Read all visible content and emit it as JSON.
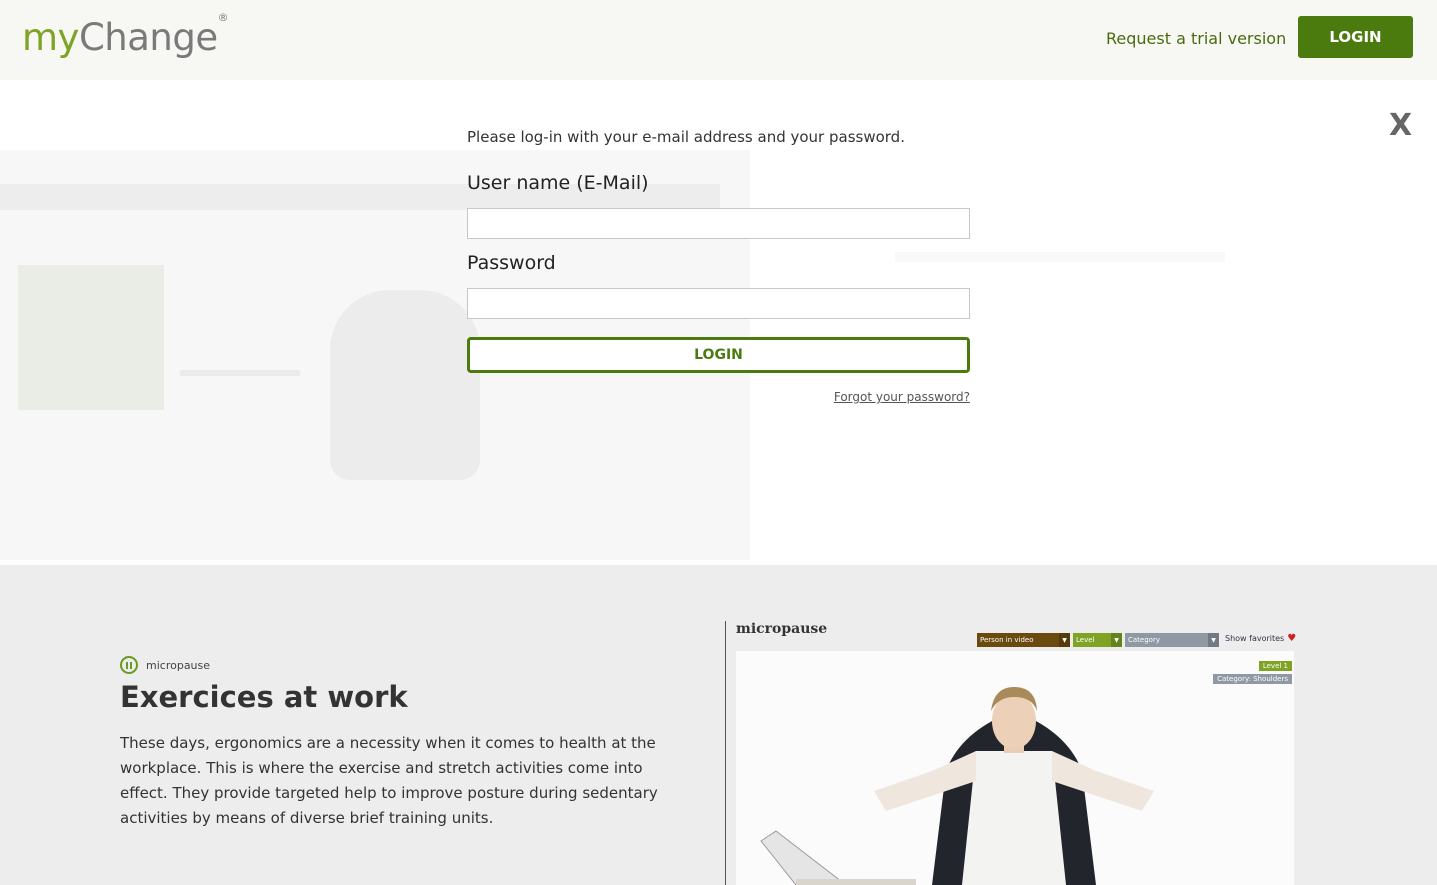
{
  "header": {
    "logo_my": "my",
    "logo_change": "Change",
    "logo_reg": "®",
    "trial_link": "Request a trial version",
    "login_button": "LOGIN"
  },
  "modal": {
    "close_label": "X",
    "intro": "Please log-in with your e-mail address and your password.",
    "username_label": "User name (E-Mail)",
    "username_value": "",
    "password_label": "Password",
    "password_value": "",
    "login_button": "LOGIN",
    "forgot_link": "Forgot your password?"
  },
  "feature": {
    "badge_label": "micropause",
    "title_bold": "Exercices",
    "title_rest": " at work",
    "body": "These days, ergonomics are a necessity when it comes to health at the workplace. This is where the exercise and stretch activities come into effect. They provide targeted help to improve posture during sedentary activities by means of diverse brief training units."
  },
  "preview": {
    "app_title": "micropause",
    "filters": [
      {
        "label": "Person in video",
        "color": "#6b4a0f"
      },
      {
        "label": "Level",
        "color": "#7fa324"
      },
      {
        "label": "Category",
        "color": "#8f98a3"
      }
    ],
    "favorites_label": "Show favorites",
    "level_tag": "Level 1",
    "category_tag": "Category: Shoulders"
  },
  "colors": {
    "brand_green": "#4b7a0e",
    "logo_green": "#7fa324",
    "header_bg": "#f7f8f4",
    "section_bg": "#ededed"
  }
}
